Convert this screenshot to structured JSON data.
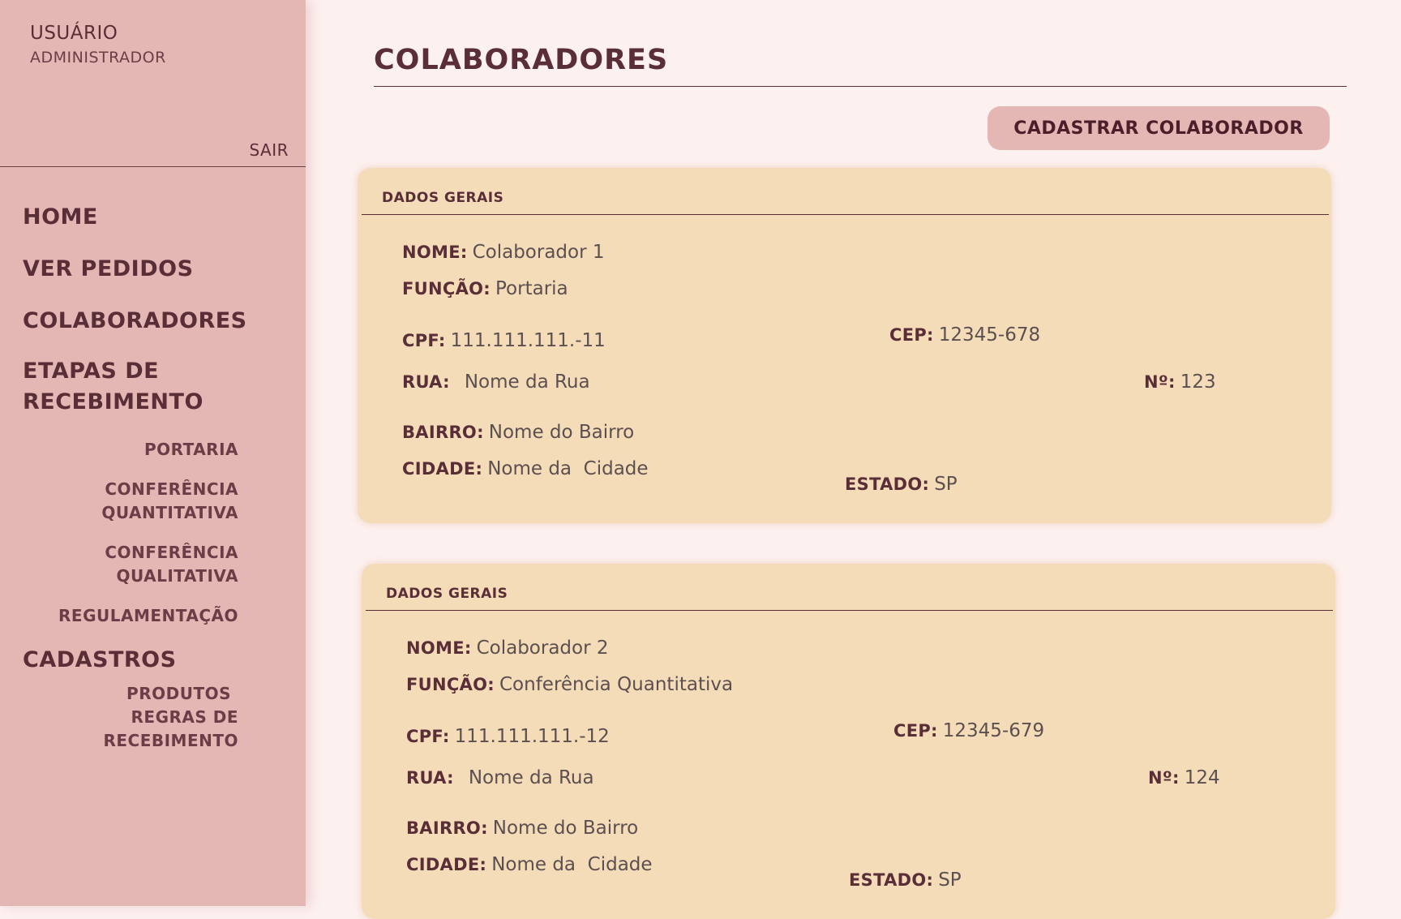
{
  "sidebar": {
    "user_title": "USUÁRIO",
    "user_role": "ADMINISTRADOR",
    "logout": "SAIR",
    "nav": {
      "home": "HOME",
      "orders": "VER PEDIDOS",
      "employees": "COLABORADORES",
      "stages_line1": "ETAPAS DE",
      "stages_line2": "RECEBIMENTO",
      "gate": "PORTARIA",
      "quant_line1": "CONFERÊNCIA",
      "quant_line2": "QUANTITATIVA",
      "qual_line1": "CONFERÊNCIA",
      "qual_line2": "QUALITATIVA",
      "regulation": "REGULAMENTAÇÃO",
      "registrations": "CADASTROS",
      "products": "PRODUTOS",
      "rules_line1": "REGRAS DE",
      "rules_line2": "RECEBIMENTO"
    }
  },
  "main": {
    "title": "COLABORADORES",
    "add_button": "CADASTRAR COLABORADOR",
    "labels": {
      "section": "DADOS GERAIS",
      "name": "NOME:",
      "role": "FUNÇÃO:",
      "cpf": "CPF:",
      "cep": "CEP:",
      "street": "RUA:",
      "number": "Nº:",
      "district": "BAIRRO:",
      "city": "CIDADE:",
      "state": "ESTADO:"
    },
    "employees": [
      {
        "name": "Colaborador 1",
        "role": "Portaria",
        "cpf": "111.111.111.-11",
        "cep": "12345-678",
        "street": "Nome da Rua",
        "number": "123",
        "district": "Nome do Bairro",
        "city": "Nome da  Cidade",
        "state": "SP"
      },
      {
        "name": "Colaborador 2",
        "role": "Conferência Quantitativa",
        "cpf": "111.111.111.-12",
        "cep": "12345-679",
        "street": "Nome da Rua",
        "number": "124",
        "district": "Nome do Bairro",
        "city": "Nome da  Cidade",
        "state": "SP"
      }
    ]
  }
}
